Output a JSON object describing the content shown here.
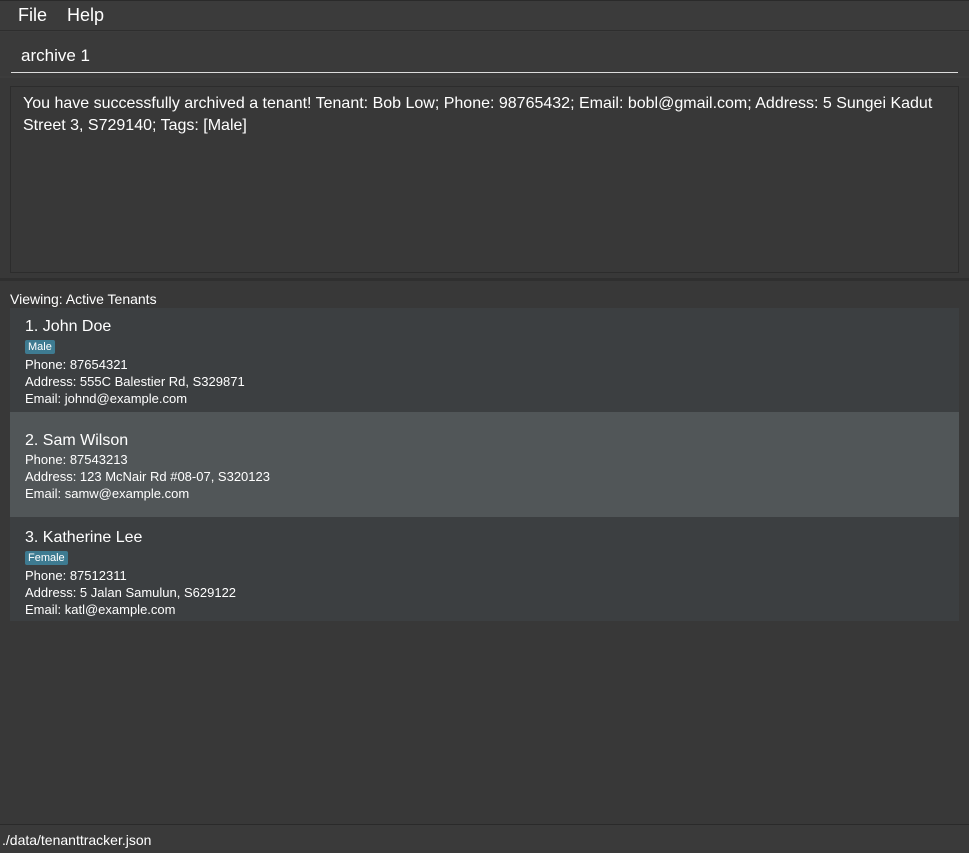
{
  "menu": {
    "file": "File",
    "help": "Help"
  },
  "command": {
    "value": "archive 1"
  },
  "result": {
    "text": "You have successfully archived a tenant! Tenant: Bob Low; Phone: 98765432; Email: bobl@gmail.com; Address: 5 Sungei Kadut Street 3, S729140; Tags: [Male]"
  },
  "list": {
    "viewing_label": "Viewing: Active Tenants",
    "tenants": [
      {
        "name": "1. John Doe",
        "tag": "Male",
        "phone": "Phone: 87654321",
        "address": "Address: 555C Balestier Rd, S329871",
        "email": "Email: johnd@example.com"
      },
      {
        "name": "2. Sam Wilson",
        "tag": "",
        "phone": "Phone: 87543213",
        "address": "Address: 123 McNair Rd #08-07, S320123",
        "email": "Email: samw@example.com"
      },
      {
        "name": "3. Katherine Lee",
        "tag": "Female",
        "phone": "Phone: 87512311",
        "address": "Address: 5 Jalan Samulun, S629122",
        "email": "Email: katl@example.com"
      }
    ]
  },
  "status": {
    "file_path": "./data/tenanttracker.json"
  },
  "colors": {
    "background": "#383838",
    "card": "#3c3f41",
    "selected_card": "#515658",
    "tag": "#3e7b91"
  }
}
